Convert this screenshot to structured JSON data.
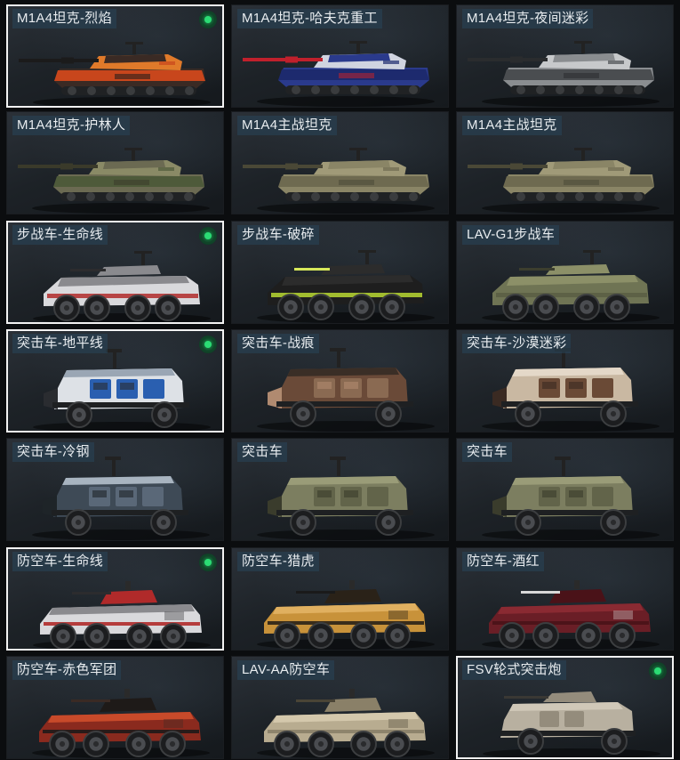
{
  "cards": [
    {
      "label": "M1A4坦克-烈焰",
      "kind": "tank",
      "selected": true,
      "badge": true,
      "colors": [
        "#3a2a24",
        "#c8461c",
        "#e07a2a",
        "#1b1b1b"
      ]
    },
    {
      "label": "M1A4坦克-哈夫克重工",
      "kind": "tank",
      "selected": false,
      "badge": false,
      "colors": [
        "#2a3a8c",
        "#1d2a6e",
        "#d0d4e0",
        "#c0202c"
      ]
    },
    {
      "label": "M1A4坦克-夜间迷彩",
      "kind": "tank",
      "selected": false,
      "badge": false,
      "colors": [
        "#8a8d90",
        "#4a4d50",
        "#c7c9cb",
        "#2a2c2e"
      ]
    },
    {
      "label": "M1A4坦克-护林人",
      "kind": "tank",
      "selected": false,
      "badge": false,
      "colors": [
        "#6b6a52",
        "#4e5a3a",
        "#8a8a66",
        "#3a3a2a"
      ]
    },
    {
      "label": "M1A4主战坦克",
      "kind": "tank",
      "selected": false,
      "badge": false,
      "colors": [
        "#8a8566",
        "#6e6a50",
        "#a09a78",
        "#4a4836"
      ]
    },
    {
      "label": "M1A4主战坦克",
      "kind": "tank",
      "selected": false,
      "badge": false,
      "colors": [
        "#8a8566",
        "#6e6a50",
        "#a09a78",
        "#4a4836"
      ]
    },
    {
      "label": "步战车-生命线",
      "kind": "ifv",
      "selected": true,
      "badge": true,
      "colors": [
        "#d9d9dc",
        "#b02a2a",
        "#8a8a8e",
        "#2c2c2e"
      ]
    },
    {
      "label": "步战车-破碎",
      "kind": "ifv",
      "selected": false,
      "badge": false,
      "colors": [
        "#1e1e1e",
        "#b9d832",
        "#2c2c2c",
        "#d8e85a"
      ]
    },
    {
      "label": "LAV-G1步战车",
      "kind": "ifv",
      "selected": false,
      "badge": false,
      "colors": [
        "#6f7454",
        "#5a5e44",
        "#8c9068",
        "#3c3e2e"
      ]
    },
    {
      "label": "突击车-地平线",
      "kind": "mrap",
      "selected": true,
      "badge": true,
      "colors": [
        "#dde1e6",
        "#2a5fb0",
        "#9aa6b4",
        "#2a2c30"
      ]
    },
    {
      "label": "突击车-战痕",
      "kind": "mrap",
      "selected": false,
      "badge": false,
      "colors": [
        "#6a4a38",
        "#8a6a52",
        "#3a2e26",
        "#b08a70"
      ]
    },
    {
      "label": "突击车-沙漠迷彩",
      "kind": "mrap",
      "selected": false,
      "badge": false,
      "colors": [
        "#c9b8a2",
        "#6a4a36",
        "#e4d8c8",
        "#3a2a22"
      ]
    },
    {
      "label": "突击车-冷钢",
      "kind": "mrap",
      "selected": false,
      "badge": false,
      "colors": [
        "#3e4a56",
        "#5a6878",
        "#a8b4c0",
        "#1e2428"
      ]
    },
    {
      "label": "突击车",
      "kind": "mrap",
      "selected": false,
      "badge": false,
      "colors": [
        "#7c7e60",
        "#62644a",
        "#9a9c78",
        "#3a3c2c"
      ]
    },
    {
      "label": "突击车",
      "kind": "mrap",
      "selected": false,
      "badge": false,
      "colors": [
        "#7c7e60",
        "#62644a",
        "#9a9c78",
        "#3a3c2c"
      ]
    },
    {
      "label": "防空车-生命线",
      "kind": "aa",
      "selected": true,
      "badge": true,
      "colors": [
        "#d9d9dc",
        "#b02a2a",
        "#8a8a8e",
        "#2c2c2e"
      ]
    },
    {
      "label": "防空车-猎虎",
      "kind": "aa",
      "selected": false,
      "badge": false,
      "colors": [
        "#c8923a",
        "#2a2218",
        "#e0b060",
        "#1a1a1a"
      ]
    },
    {
      "label": "防空车-酒红",
      "kind": "aa",
      "selected": false,
      "badge": false,
      "colors": [
        "#6a1e26",
        "#4a1218",
        "#8a2a32",
        "#d8d8d8"
      ]
    },
    {
      "label": "防空车-赤色军团",
      "kind": "aa",
      "selected": false,
      "badge": false,
      "colors": [
        "#8a2a1e",
        "#1e1a18",
        "#c84a2a",
        "#3a2a24"
      ]
    },
    {
      "label": "LAV-AA防空车",
      "kind": "aa",
      "selected": false,
      "badge": false,
      "colors": [
        "#b8ac90",
        "#8a8068",
        "#d4c8ac",
        "#4a4436"
      ]
    },
    {
      "label": "FSV轮式突击炮",
      "kind": "fsv",
      "selected": true,
      "badge": true,
      "colors": [
        "#b8b0a0",
        "#948c7c",
        "#d0c8b8",
        "#3a3834"
      ]
    }
  ]
}
